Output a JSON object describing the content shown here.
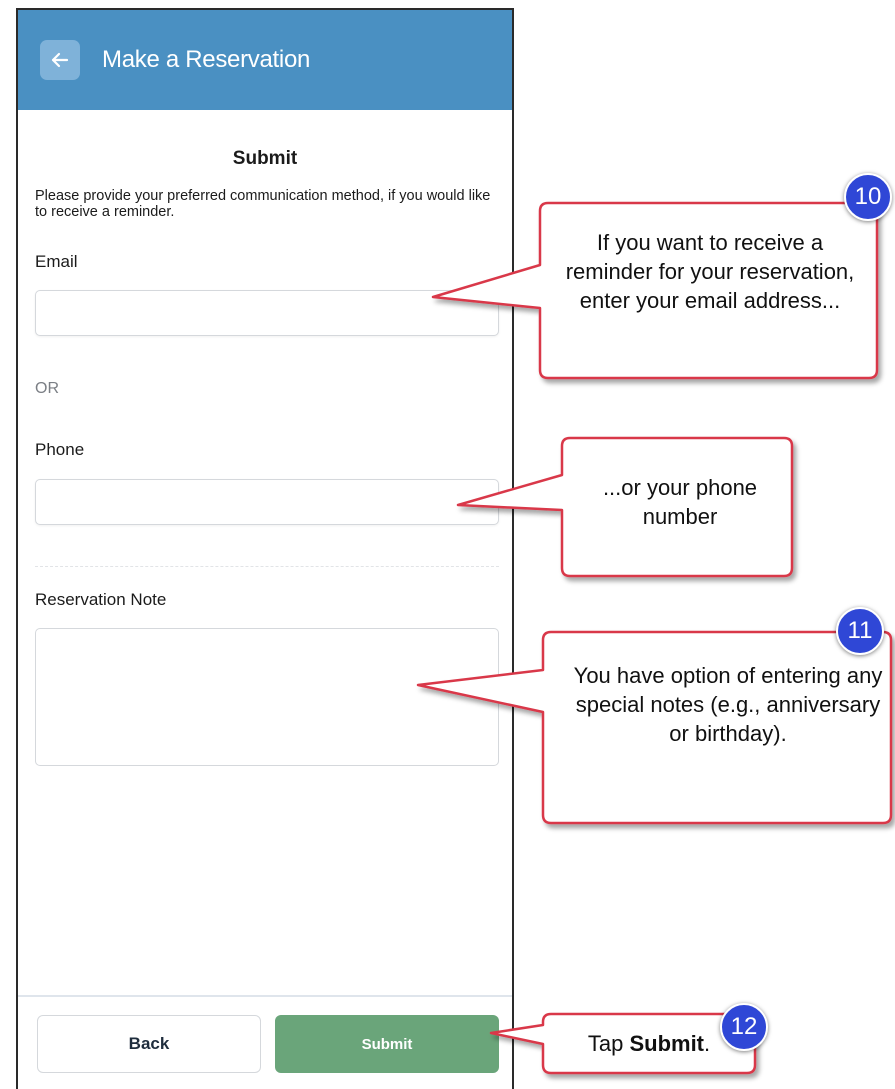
{
  "header": {
    "title": "Make a Reservation"
  },
  "form": {
    "section_title": "Submit",
    "intro": "Please provide your preferred communication method, if you would like to receive a reminder.",
    "email_label": "Email",
    "email_value": "",
    "or_text": "OR",
    "phone_label": "Phone",
    "phone_value": "",
    "note_label": "Reservation Note",
    "note_value": ""
  },
  "footer": {
    "back_label": "Back",
    "submit_label": "Submit"
  },
  "callouts": {
    "c10": {
      "badge": "10",
      "text": "If you want to receive a reminder for your reservation, enter your email address..."
    },
    "phone": {
      "text": "...or your phone number"
    },
    "c11": {
      "badge": "11",
      "text": "You have option of entering any special notes (e.g., anniversary or birthday)."
    },
    "c12": {
      "badge": "12",
      "text_prefix": "Tap ",
      "text_bold": "Submit",
      "text_suffix": "."
    }
  },
  "colors": {
    "header": "#4a90c2",
    "submit": "#6aa57a",
    "callout_border": "#d9394a",
    "badge": "#2f47d6"
  }
}
